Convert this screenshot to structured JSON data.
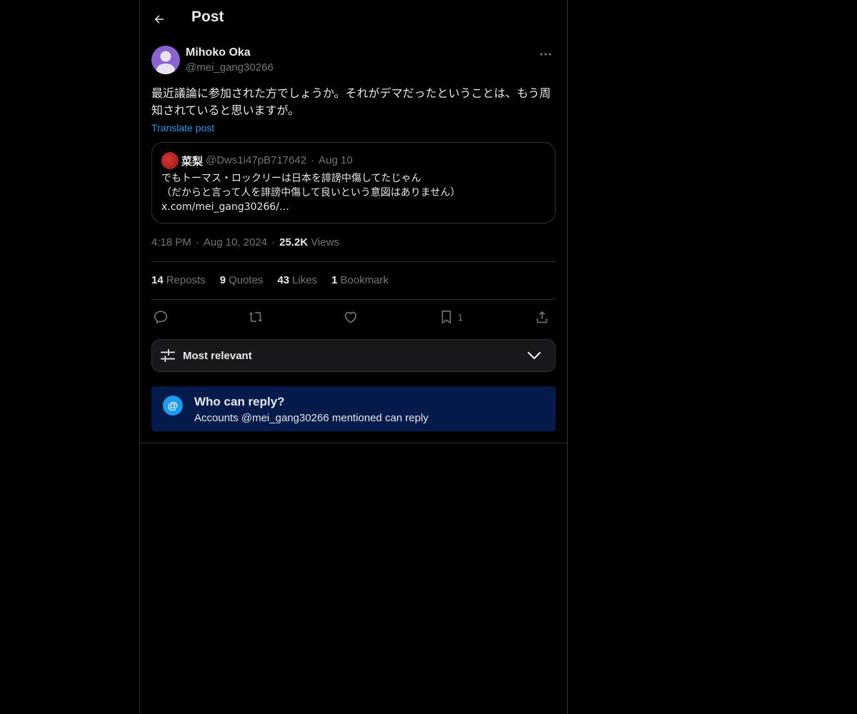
{
  "header": {
    "title": "Post",
    "back_icon": "arrow-left-icon"
  },
  "post": {
    "author_name": "Mihoko Oka",
    "author_handle": "@mei_gang30266",
    "avatar_color": "#8a63d2",
    "text": "最近議論に参加された方でしょうか。それがデマだったということは、もう周知されていると思いますが。",
    "translate_label": "Translate post",
    "time": "4:18 PM",
    "date": "Aug 10, 2024",
    "views_count": "25.2K",
    "views_label": "Views"
  },
  "quote": {
    "name": "菜梨",
    "handle": "@Dws1i47pB717642",
    "date": "Aug 10",
    "lines": [
      "でもトーマス・ロックリーは日本を誹謗中傷してたじゃん",
      "（だからと言って人を誹謗中傷して良いという意図はありません）",
      "x.com/mei_gang30266/…"
    ]
  },
  "stats": {
    "reposts_count": "14",
    "reposts_label": "Reposts",
    "quotes_count": "9",
    "quotes_label": "Quotes",
    "likes_count": "43",
    "likes_label": "Likes",
    "bookmarks_count": "1",
    "bookmarks_label": "Bookmark"
  },
  "actions": {
    "reply_icon": "reply-icon",
    "repost_icon": "repost-icon",
    "like_icon": "heart-icon",
    "bookmark_icon": "bookmark-icon",
    "bookmark_count": "1",
    "share_icon": "share-icon"
  },
  "sort": {
    "label": "Most relevant"
  },
  "reply_restriction": {
    "title": "Who can reply?",
    "subtitle": "Accounts @mei_gang30266 mentioned can reply",
    "icon_text": "@"
  },
  "colors": {
    "accent": "#1d9bf0",
    "background": "#000000",
    "muted": "#71767b",
    "border": "#2f3336"
  }
}
